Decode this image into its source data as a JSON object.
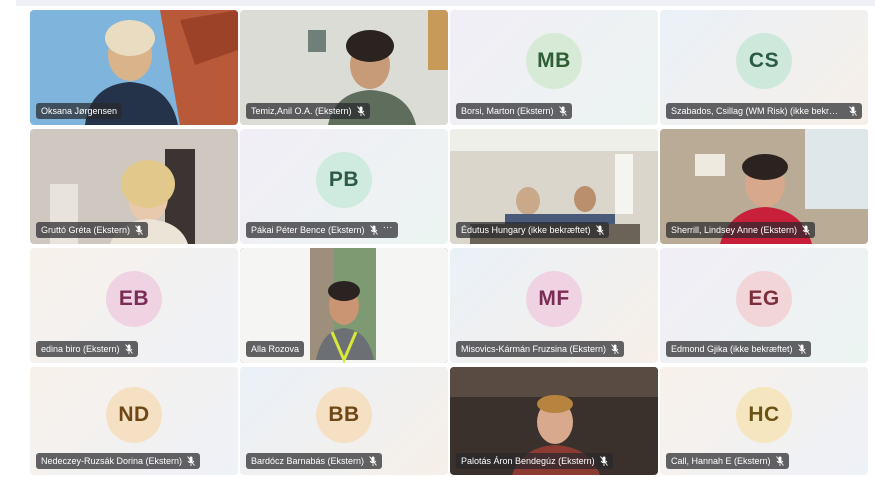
{
  "participants": [
    {
      "name": "Oksana Jørgensen",
      "video": true,
      "muted": false
    },
    {
      "name": "Temiz,Anil O.A. (Ekstern)",
      "video": true,
      "muted": true
    },
    {
      "name": "Borsi, Marton (Ekstern)",
      "initials": "MB",
      "avatar_bg": "#d6ead6",
      "avatar_fg": "#2f5d36",
      "muted": true
    },
    {
      "name": "Szabados, Csillag (WM Risk) (ikke bekræft...",
      "initials": "CS",
      "avatar_bg": "#cfe8dc",
      "avatar_fg": "#2b5b48",
      "muted": true
    },
    {
      "name": "Gruttó Gréta (Ekstern)",
      "video": true,
      "muted": true
    },
    {
      "name": "Pákai Péter Bence (Ekstern)",
      "initials": "PB",
      "avatar_bg": "#cfeadf",
      "avatar_fg": "#2b5b46",
      "muted": true,
      "more": "···"
    },
    {
      "name": "Édutus Hungary (ikke bekræftet)",
      "video": true,
      "muted": true
    },
    {
      "name": "Sherrill, Lindsey Anne (Ekstern)",
      "video": true,
      "muted": true
    },
    {
      "name": "edina biro (Ekstern)",
      "initials": "EB",
      "avatar_bg": "#efd3e3",
      "avatar_fg": "#7a2c55",
      "muted": true
    },
    {
      "name": "Alla Rozova",
      "video": true,
      "muted": false,
      "speaking": true
    },
    {
      "name": "Misovics-Kármán Fruzsina (Ekstern)",
      "initials": "MF",
      "avatar_bg": "#efd3e3",
      "avatar_fg": "#7a2c55",
      "muted": true
    },
    {
      "name": "Edmond Gjika (ikke bekræftet)",
      "initials": "EG",
      "avatar_bg": "#f2d5d8",
      "avatar_fg": "#7c2f3a",
      "muted": true
    },
    {
      "name": "Nedeczey-Ruzsák Dorina (Ekstern)",
      "initials": "ND",
      "avatar_bg": "#f6e0c4",
      "avatar_fg": "#6e4716",
      "muted": true
    },
    {
      "name": "Bardócz Barnabás (Ekstern)",
      "initials": "BB",
      "avatar_bg": "#f6e0c4",
      "avatar_fg": "#6e4716",
      "muted": true
    },
    {
      "name": "Palotás Áron Bendegúz (Ekstern)",
      "video": true,
      "muted": true
    },
    {
      "name": "Call, Hannah E (Ekstern)",
      "initials": "HC",
      "avatar_bg": "#f6e6bf",
      "avatar_fg": "#6b5214",
      "muted": true
    }
  ],
  "colors": {
    "speaking_border": "#6f66c9",
    "nameplate_bg": "#28282d"
  }
}
